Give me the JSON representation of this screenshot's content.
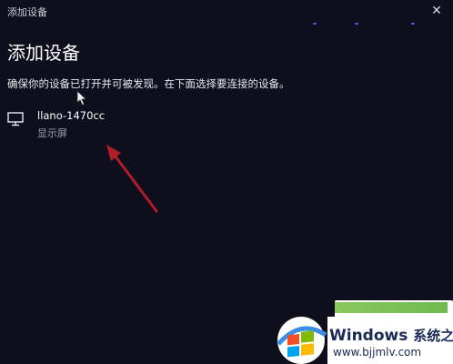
{
  "window": {
    "title": "添加设备",
    "close_glyph": "✕"
  },
  "main": {
    "heading": "添加设备",
    "instruction": "确保你的设备已打开并可被发现。在下面选择要连接的设备。",
    "devices": [
      {
        "name": "llano-1470cc",
        "type": "显示屏",
        "icon": "monitor-icon"
      }
    ]
  },
  "watermark": {
    "brand_en": "Windows",
    "brand_cn": "系统之家",
    "url": "www.bjjmlv.com"
  },
  "colors": {
    "background": "#0e0e1c",
    "annotation_arrow": "#b01e2a",
    "accent_dots": "#5a4bd8"
  }
}
